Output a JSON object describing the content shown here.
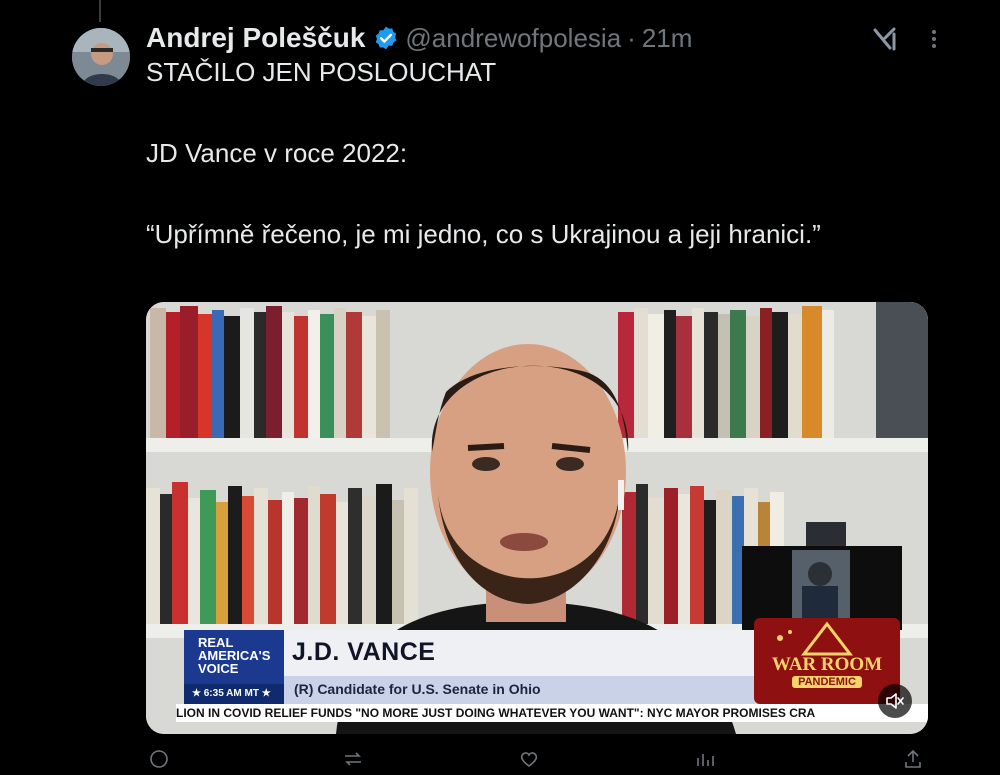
{
  "tweet": {
    "author_name": "Andrej Poleščuk",
    "handle": "@andrewofpolesia",
    "separator": "·",
    "time": "21m",
    "verified": true,
    "text_lines": [
      "STAČILO JEN POSLOUCHAT",
      "JD Vance v roce 2022:",
      "“Upřímně řečeno, je mi jedno, co s Ukrajinou a jeji hranici.”"
    ],
    "icons": {
      "verified": "verified-badge-icon",
      "grok": "grok-icon",
      "more": "more-dots-icon",
      "mute": "volume-muted-icon"
    }
  },
  "video": {
    "network_logo": "REAL AMERICA'S VOICE",
    "network_time": "★ 6:35 AM MT ★",
    "person_name": "J.D. VANCE",
    "person_subtitle": "(R) Candidate for U.S. Senate in Ohio",
    "show_logo": "WAR ROOM",
    "show_sublogo": "PANDEMIC",
    "ticker_text": "LION IN COVID RELIEF FUNDS      \"NO MORE JUST DOING WHATEVER YOU WANT\": NYC MAYOR PROMISES CRA"
  },
  "colors": {
    "background": "#000000",
    "text": "#e7e9ea",
    "muted": "#71767b",
    "verified": "#1d9bf0"
  }
}
